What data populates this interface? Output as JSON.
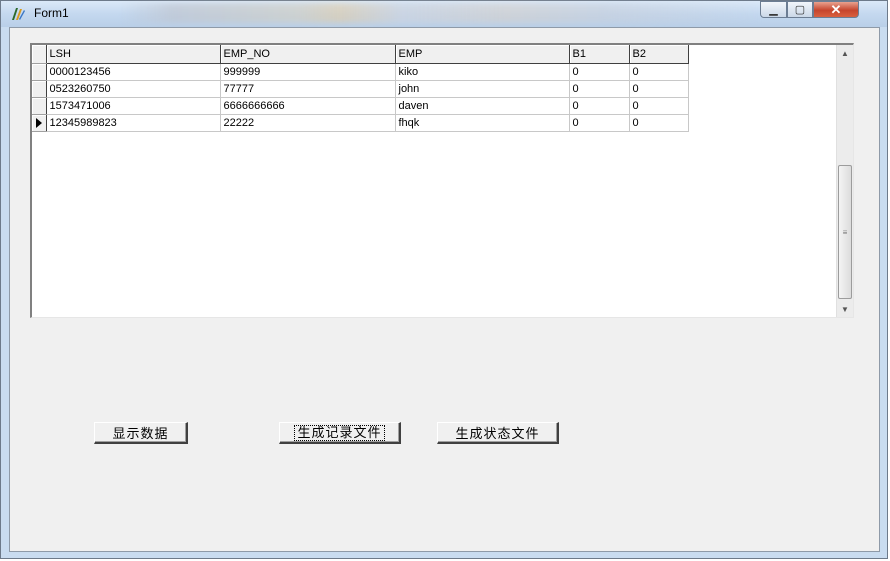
{
  "window": {
    "title": "Form1",
    "minimize_glyph": "▁",
    "maximize_glyph": "▢",
    "close_glyph": "✕"
  },
  "grid": {
    "columns": [
      "LSH",
      "EMP_NO",
      "EMP",
      "B1",
      "B2"
    ],
    "rows": [
      [
        "0000123456",
        "999999",
        "kiko",
        "0",
        "0"
      ],
      [
        "0523260750",
        "77777",
        "john",
        "0",
        "0"
      ],
      [
        "1573471006",
        "6666666666",
        "daven",
        "0",
        "0"
      ],
      [
        "12345989823",
        "22222",
        "fhqk",
        "0",
        "0"
      ]
    ],
    "current_row_index": 3
  },
  "buttons": {
    "show_data": "显示数据",
    "make_record_file": "生成记录文件",
    "make_status_file": "生成状态文件"
  },
  "icons": {
    "app": "vb-form-icon",
    "scroll_up": "▲",
    "scroll_down": "▼",
    "thumb_grip": "≡"
  }
}
